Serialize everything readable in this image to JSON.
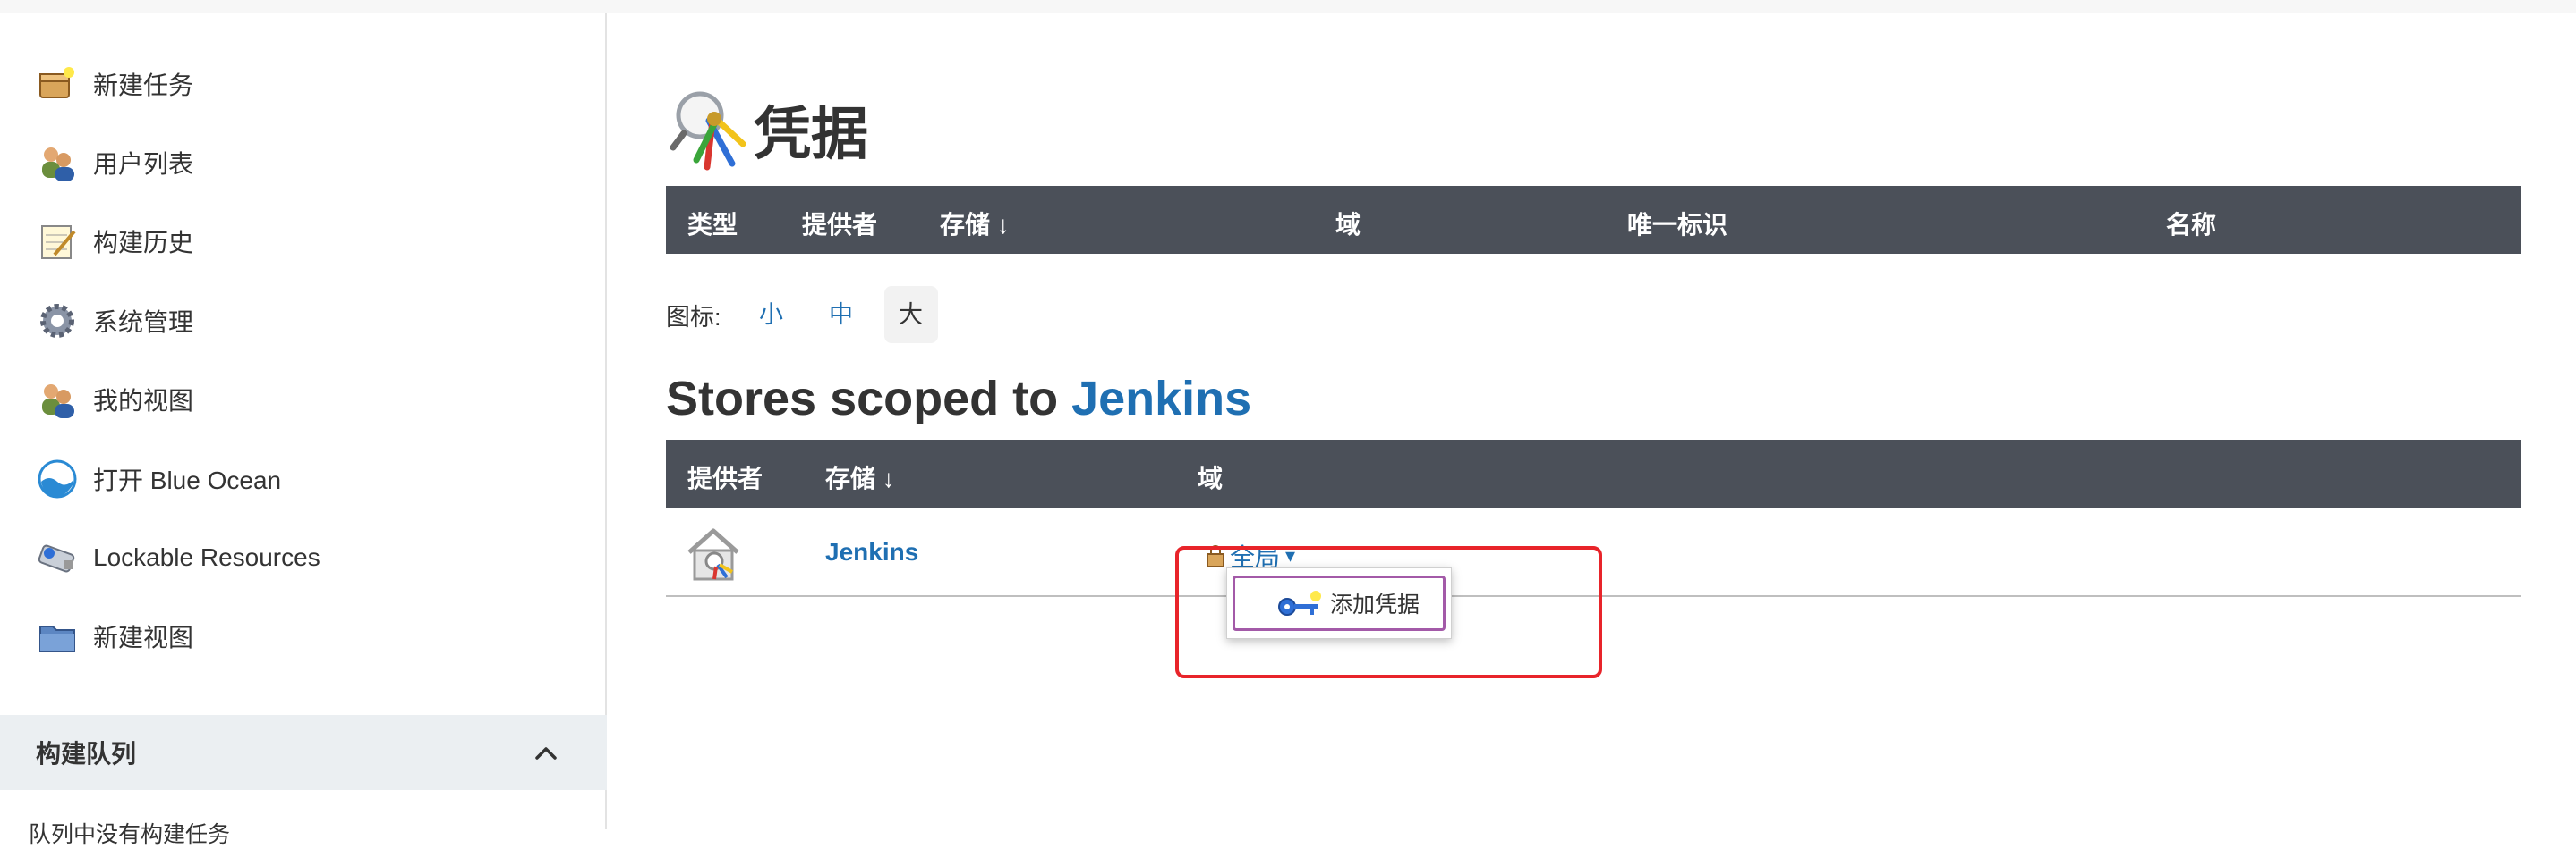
{
  "sidebar": {
    "items": [
      {
        "label": "新建任务",
        "icon": "new-task-icon"
      },
      {
        "label": "用户列表",
        "icon": "users-icon"
      },
      {
        "label": "构建历史",
        "icon": "notepad-icon"
      },
      {
        "label": "系统管理",
        "icon": "gear-icon"
      },
      {
        "label": "我的视图",
        "icon": "users-icon"
      },
      {
        "label": "打开 Blue Ocean",
        "icon": "blue-ocean-icon"
      },
      {
        "label": "Lockable Resources",
        "icon": "lockable-resources-icon"
      },
      {
        "label": "新建视图",
        "icon": "folder-icon"
      }
    ],
    "queue": {
      "title": "构建队列",
      "empty": "队列中没有构建任务"
    }
  },
  "main": {
    "title": "凭据",
    "credentials_table": {
      "columns": [
        "类型",
        "提供者",
        "存储 ↓",
        "域",
        "唯一标识",
        "名称"
      ]
    },
    "icon_size": {
      "label": "图标:",
      "options": [
        "小",
        "中",
        "大"
      ],
      "selected": "大"
    },
    "stores": {
      "title_prefix": "Stores scoped to ",
      "title_link": "Jenkins",
      "columns": [
        "提供者",
        "存储 ↓",
        "域"
      ],
      "rows": [
        {
          "store": "Jenkins",
          "domain": "全局",
          "domain_arrow": "▾"
        }
      ]
    },
    "dropdown": {
      "items": [
        "添加凭据"
      ]
    }
  },
  "colors": {
    "link": "#1f6fb2",
    "table_header": "#4b5059",
    "annotation": "#e8242a",
    "menu_highlight": "#a35aa8"
  }
}
